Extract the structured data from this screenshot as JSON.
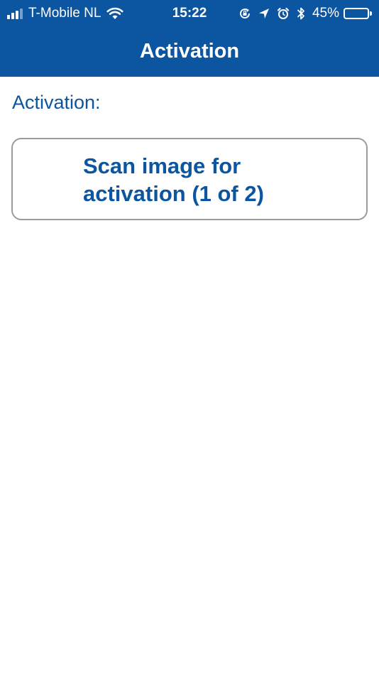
{
  "status_bar": {
    "carrier": "T-Mobile NL",
    "time": "15:22",
    "battery_percent": "45%",
    "battery_level": 0.45,
    "signal_bars_active": 3,
    "signal_bars_total": 4,
    "icons": [
      "wifi-icon",
      "screen-lock-rotation-icon",
      "location-arrow-icon",
      "alarm-icon",
      "bluetooth-icon",
      "battery-icon"
    ]
  },
  "nav": {
    "title": "Activation"
  },
  "main": {
    "section_label": "Activation:",
    "scan_button_label": "Scan image for activation (1 of 2)"
  },
  "colors": {
    "brand_blue": "#0c55a0",
    "background": "#ffffff",
    "button_border": "#9b9b9b"
  }
}
